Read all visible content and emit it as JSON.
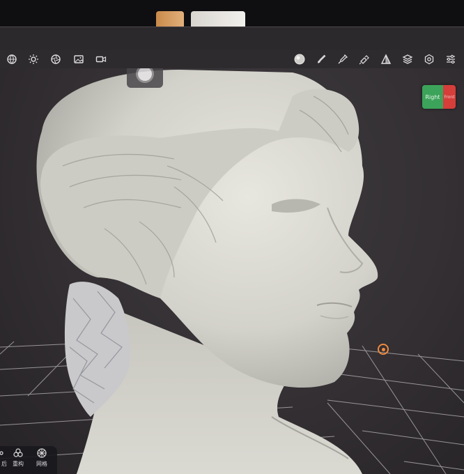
{
  "toolbar": {
    "left": [
      "globe-icon",
      "sun-icon",
      "aperture-icon",
      "image-icon",
      "video-camera-icon"
    ],
    "right": [
      "material-sphere-icon",
      "brush-icon",
      "eyedropper-icon",
      "flashlight-icon",
      "triangle-icon",
      "layers-icon",
      "settings-icon",
      "sliders-icon"
    ]
  },
  "view_cube": {
    "face_label": "Right",
    "side_label": "Front"
  },
  "bottom_tools": {
    "item1_label": "重构",
    "item2_label": "网格",
    "partial_label": "后"
  },
  "colors": {
    "accent_orange": "#f08a3c",
    "cube_green": "#3ca35a",
    "cube_red": "#d63e3a",
    "model": "#dcdbd4"
  }
}
